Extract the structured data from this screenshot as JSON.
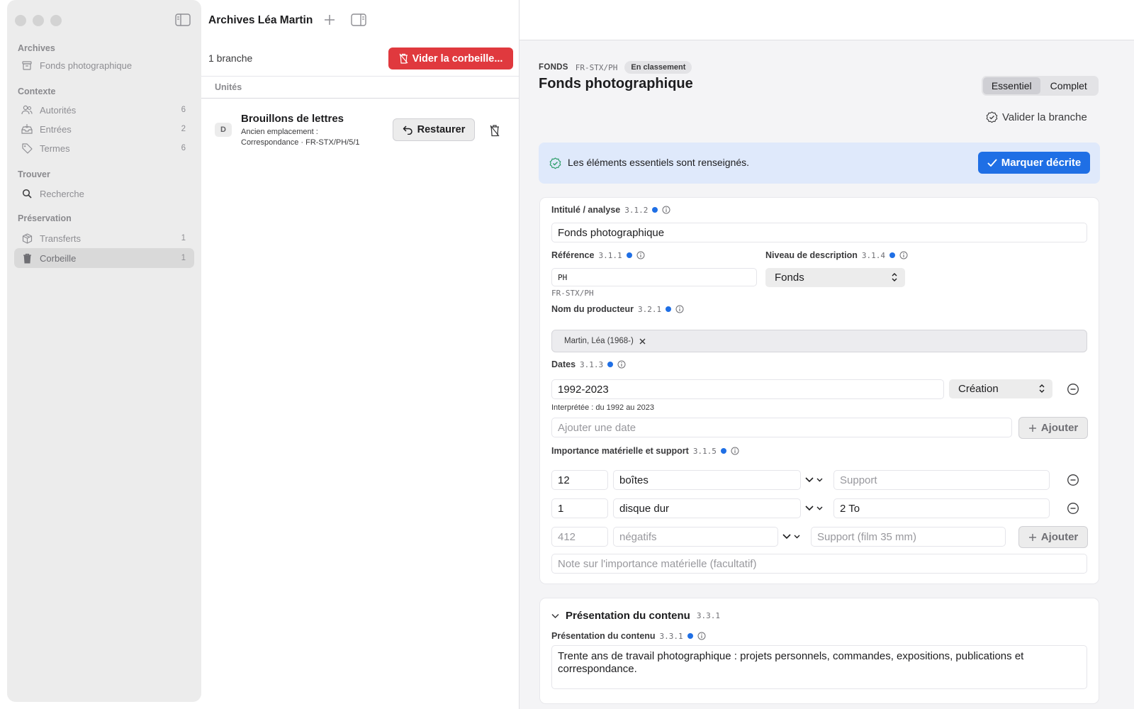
{
  "sidebar": {
    "groups": [
      {
        "title": "Archives",
        "items": [
          {
            "label": "Fonds photographique",
            "count": "",
            "icon": "archive-box-icon"
          }
        ]
      },
      {
        "title": "Contexte",
        "items": [
          {
            "label": "Autorités",
            "count": "6",
            "icon": "people-icon"
          },
          {
            "label": "Entrées",
            "count": "2",
            "icon": "inbox-icon"
          },
          {
            "label": "Termes",
            "count": "6",
            "icon": "tag-icon"
          }
        ]
      },
      {
        "title": "Trouver",
        "items": [
          {
            "label": "Recherche",
            "count": "",
            "icon": "search-icon"
          }
        ]
      },
      {
        "title": "Préservation",
        "items": [
          {
            "label": "Transferts",
            "count": "1",
            "icon": "package-icon"
          },
          {
            "label": "Corbeille",
            "count": "1",
            "icon": "trash-icon"
          }
        ]
      }
    ]
  },
  "middle": {
    "title": "Archives Léa Martin",
    "count_label": "1 branche",
    "empty_trash_label": "Vider la corbeille...",
    "column_header": "Unités",
    "rows": [
      {
        "badge": "D",
        "title": "Brouillons de lettres",
        "sub1": "Ancien emplacement :",
        "sub2": "Correspondance · FR-STX/PH/5/1",
        "restore_label": "Restaurer"
      }
    ]
  },
  "detail": {
    "level": "FONDS",
    "reference": "FR-STX/PH",
    "status": "En classement",
    "title": "Fonds photographique",
    "segments": [
      "Essentiel",
      "Complet"
    ],
    "active_segment": "Essentiel",
    "validate_label": "Valider la branche",
    "banner_text": "Les éléments essentiels sont renseignés.",
    "mark_label": "Marquer décrite",
    "fields": {
      "title_label": "Intitulé / analyse",
      "title_code": "3.1.2",
      "title_value": "Fonds photographique",
      "ref_label": "Référence",
      "ref_code": "3.1.1",
      "ref_value": "PH",
      "ref_hint": "FR-STX/PH",
      "level_label": "Niveau de description",
      "level_code": "3.1.4",
      "level_value": "Fonds",
      "creator_label": "Nom du producteur",
      "creator_code": "3.2.1",
      "creator_token": "Martin, Léa (1968-)",
      "dates_label": "Dates",
      "dates_code": "3.1.3",
      "dates_value": "1992-2023",
      "dates_type": "Création",
      "dates_hint": "Interprétée : du 1992 au 2023",
      "dates_add_placeholder": "Ajouter une date",
      "add_label": "Ajouter",
      "extent_label": "Importance matérielle et support",
      "extent_code": "3.1.5",
      "extent_rows": [
        {
          "qty": "12",
          "unit": "boîtes",
          "support": "",
          "support_placeholder": "Support"
        },
        {
          "qty": "1",
          "unit": "disque dur",
          "support": "2 To",
          "support_placeholder": "Support"
        }
      ],
      "extent_new_qty_placeholder": "412",
      "extent_new_unit_placeholder": "négatifs",
      "extent_new_support_placeholder": "Support (film 35 mm)",
      "extent_note_placeholder": "Note sur l'importance matérielle (facultatif)"
    },
    "section2": {
      "title": "Présentation du contenu",
      "code": "3.3.1",
      "field_label": "Présentation du contenu",
      "field_code": "3.3.1",
      "value": "Trente ans de travail photographique : projets personnels, commandes, expositions, publications et correspondance."
    }
  },
  "colors": {
    "accent": "#1f6fe5",
    "danger": "#e0393e",
    "banner": "#dfe9fb",
    "dot": "#1f6fe5"
  }
}
